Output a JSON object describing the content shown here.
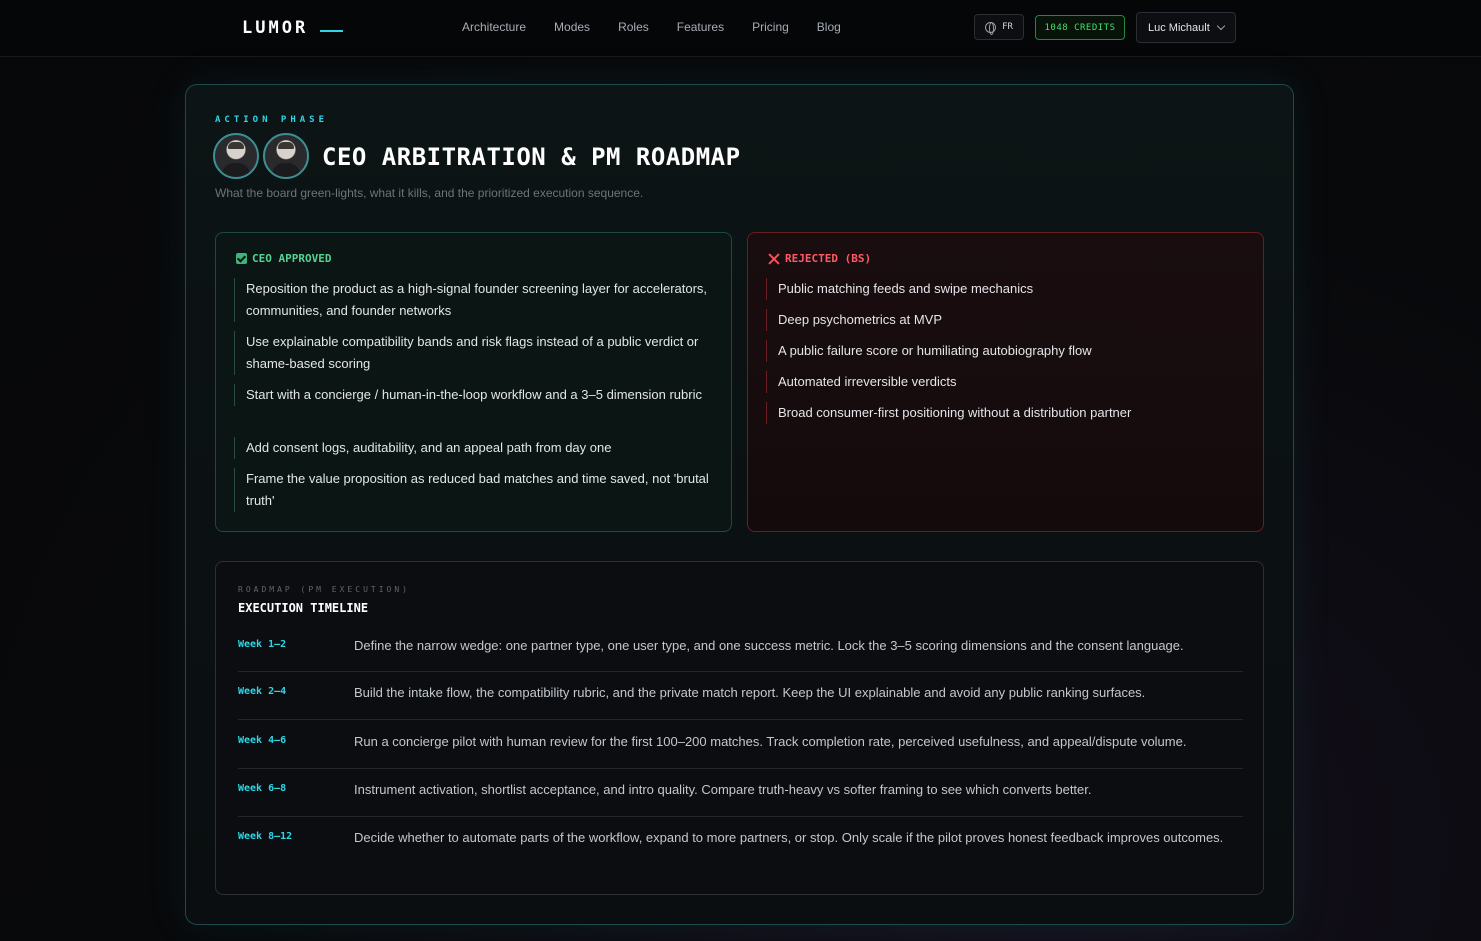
{
  "nav": {
    "logo": "LUMOR",
    "links": [
      "Architecture",
      "Modes",
      "Roles",
      "Features",
      "Pricing",
      "Blog"
    ],
    "lang": "FR",
    "credits": "1048 CREDITS",
    "user": "Luc Michault"
  },
  "header": {
    "phase": "ACTION PHASE",
    "title": "CEO ARBITRATION & PM ROADMAP",
    "subtitle": "What the board green-lights, what it kills, and the prioritized execution sequence."
  },
  "approved": {
    "heading": "CEO APPROVED",
    "items": [
      "Reposition the product as a high-signal founder screening layer for accelerators, communities, and founder networks",
      "Use explainable compatibility bands and risk flags instead of a public verdict or shame-based scoring",
      "Start with a concierge / human-in-the-loop workflow and a 3–5 dimension rubric",
      "Add consent logs, auditability, and an appeal path from day one",
      "Frame the value proposition as reduced bad matches and time saved, not 'brutal truth'"
    ]
  },
  "rejected": {
    "heading": "REJECTED (BS)",
    "items": [
      "Public matching feeds and swipe mechanics",
      "Deep psychometrics at MVP",
      "A public failure score or humiliating autobiography flow",
      "Automated irreversible verdicts",
      "Broad consumer-first positioning without a distribution partner"
    ]
  },
  "roadmap": {
    "label": "ROADMAP (PM EXECUTION)",
    "title": "EXECUTION TIMELINE",
    "rows": [
      {
        "week": "Week 1–2",
        "text": "Define the narrow wedge: one partner type, one user type, and one success metric. Lock the 3–5 scoring dimensions and the consent language."
      },
      {
        "week": "Week 2–4",
        "text": "Build the intake flow, the compatibility rubric, and the private match report. Keep the UI explainable and avoid any public ranking surfaces."
      },
      {
        "week": "Week 4–6",
        "text": "Run a concierge pilot with human review for the first 100–200 matches. Track completion rate, perceived usefulness, and appeal/dispute volume."
      },
      {
        "week": "Week 6–8",
        "text": "Instrument activation, shortlist acceptance, and intro quality. Compare truth-heavy vs softer framing to see which converts better."
      },
      {
        "week": "Week 8–12",
        "text": "Decide whether to automate parts of the workflow, expand to more partners, or stop. Only scale if the pilot proves honest feedback improves outcomes."
      }
    ]
  }
}
